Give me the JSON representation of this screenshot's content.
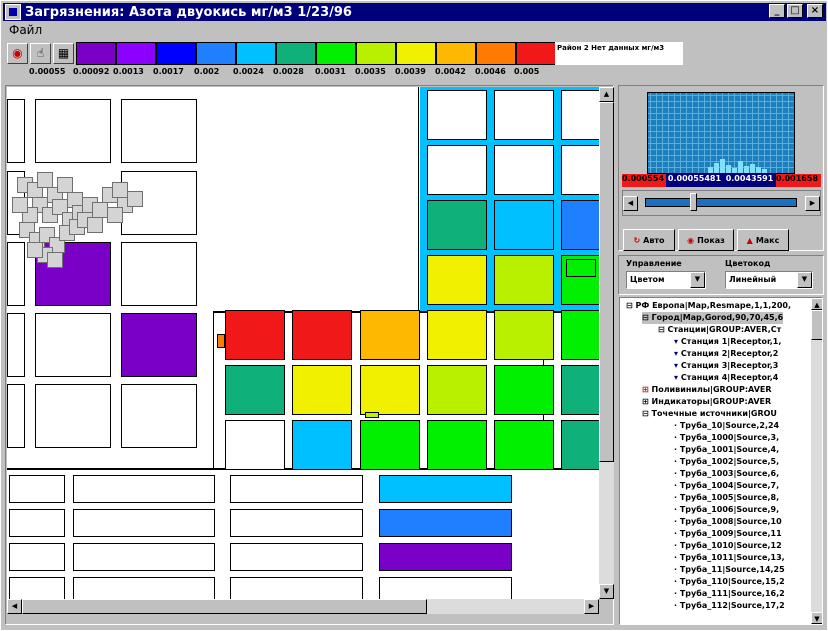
{
  "window": {
    "title": "Загрязнения: Азота двуокись  мг/м3  1/23/96"
  },
  "menu": {
    "file": "Файл"
  },
  "palette": {
    "colors": [
      "#7a00c8",
      "#8c00ff",
      "#0000ff",
      "#1e7fff",
      "#00c0ff",
      "#10b07a",
      "#00f000",
      "#b8f000",
      "#f0f000",
      "#ffb800",
      "#ff7a00",
      "#f01818"
    ],
    "ticks": [
      "0.00055",
      "0.00092",
      "0.0013",
      "0.0017",
      "0.002",
      "0.0024",
      "0.0028",
      "0.0031",
      "0.0035",
      "0.0039",
      "0.0042",
      "0.0046",
      "0.005"
    ],
    "legend_text": "Район 2  Нет данных мг/м3"
  },
  "range": {
    "min": "0.000554",
    "low": "0.00055481",
    "high": "0.0043591",
    "max": "0.001658"
  },
  "buttons": {
    "auto": "Авто",
    "show": "Показ",
    "max": "Макс"
  },
  "controls": {
    "control_label": "Управление",
    "colorcode_label": "Цветокод",
    "control_value": "Цветом",
    "colorcode_value": "Линейный"
  },
  "tree": [
    "РФ Европа|Map,Resmape,1,1,200,",
    "Город|Map,Gorod,90,70,45,6",
    "Станции|GROUP:AVER,Ст",
    "Станция 1|Receptor,1,",
    "Станция 2|Receptor,2",
    "Станция 3|Receptor,3",
    "Станция 4|Receptor,4",
    "Поливинилы|GROUP:AVER",
    "Индикаторы|GROUP:AVER",
    "Точечные источники|GROU",
    "Труба_10|Source,2,24",
    "Труба_1000|Source,3,",
    "Труба_1001|Source,4,",
    "Труба_1002|Source,5,",
    "Труба_1003|Source,6,",
    "Труба_1004|Source,7,",
    "Труба_1005|Source,8,",
    "Труба_1006|Source,9,",
    "Труба_1008|Source,10",
    "Труба_1009|Source,11",
    "Труба_1010|Source,12",
    "Труба_1011|Source,13,",
    "Труба_11|Source,14,25",
    "Труба_110|Source,15,2",
    "Труба_111|Source,16,2",
    "Труба_112|Source,17,2"
  ]
}
